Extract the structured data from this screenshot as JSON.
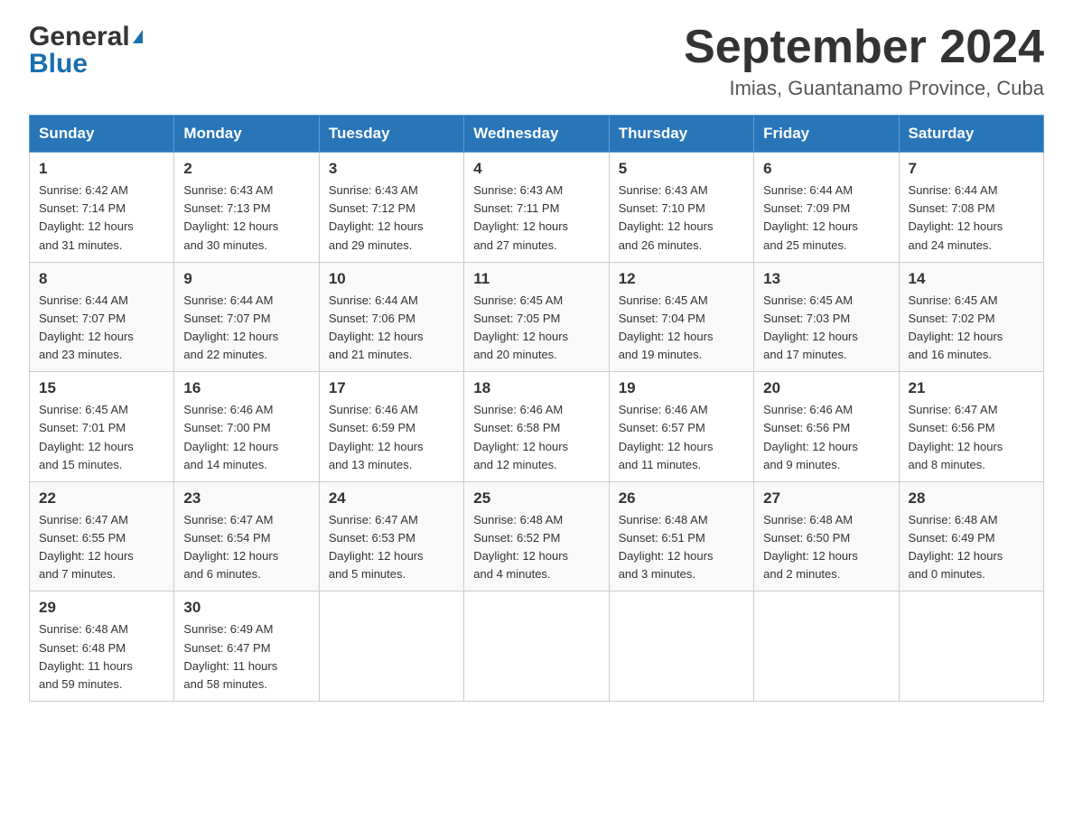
{
  "header": {
    "logo_general": "General",
    "logo_blue": "Blue",
    "month_title": "September 2024",
    "location": "Imias, Guantanamo Province, Cuba"
  },
  "columns": [
    "Sunday",
    "Monday",
    "Tuesday",
    "Wednesday",
    "Thursday",
    "Friday",
    "Saturday"
  ],
  "weeks": [
    [
      {
        "day": "1",
        "sunrise": "6:42 AM",
        "sunset": "7:14 PM",
        "daylight": "12 hours and 31 minutes."
      },
      {
        "day": "2",
        "sunrise": "6:43 AM",
        "sunset": "7:13 PM",
        "daylight": "12 hours and 30 minutes."
      },
      {
        "day": "3",
        "sunrise": "6:43 AM",
        "sunset": "7:12 PM",
        "daylight": "12 hours and 29 minutes."
      },
      {
        "day": "4",
        "sunrise": "6:43 AM",
        "sunset": "7:11 PM",
        "daylight": "12 hours and 27 minutes."
      },
      {
        "day": "5",
        "sunrise": "6:43 AM",
        "sunset": "7:10 PM",
        "daylight": "12 hours and 26 minutes."
      },
      {
        "day": "6",
        "sunrise": "6:44 AM",
        "sunset": "7:09 PM",
        "daylight": "12 hours and 25 minutes."
      },
      {
        "day": "7",
        "sunrise": "6:44 AM",
        "sunset": "7:08 PM",
        "daylight": "12 hours and 24 minutes."
      }
    ],
    [
      {
        "day": "8",
        "sunrise": "6:44 AM",
        "sunset": "7:07 PM",
        "daylight": "12 hours and 23 minutes."
      },
      {
        "day": "9",
        "sunrise": "6:44 AM",
        "sunset": "7:07 PM",
        "daylight": "12 hours and 22 minutes."
      },
      {
        "day": "10",
        "sunrise": "6:44 AM",
        "sunset": "7:06 PM",
        "daylight": "12 hours and 21 minutes."
      },
      {
        "day": "11",
        "sunrise": "6:45 AM",
        "sunset": "7:05 PM",
        "daylight": "12 hours and 20 minutes."
      },
      {
        "day": "12",
        "sunrise": "6:45 AM",
        "sunset": "7:04 PM",
        "daylight": "12 hours and 19 minutes."
      },
      {
        "day": "13",
        "sunrise": "6:45 AM",
        "sunset": "7:03 PM",
        "daylight": "12 hours and 17 minutes."
      },
      {
        "day": "14",
        "sunrise": "6:45 AM",
        "sunset": "7:02 PM",
        "daylight": "12 hours and 16 minutes."
      }
    ],
    [
      {
        "day": "15",
        "sunrise": "6:45 AM",
        "sunset": "7:01 PM",
        "daylight": "12 hours and 15 minutes."
      },
      {
        "day": "16",
        "sunrise": "6:46 AM",
        "sunset": "7:00 PM",
        "daylight": "12 hours and 14 minutes."
      },
      {
        "day": "17",
        "sunrise": "6:46 AM",
        "sunset": "6:59 PM",
        "daylight": "12 hours and 13 minutes."
      },
      {
        "day": "18",
        "sunrise": "6:46 AM",
        "sunset": "6:58 PM",
        "daylight": "12 hours and 12 minutes."
      },
      {
        "day": "19",
        "sunrise": "6:46 AM",
        "sunset": "6:57 PM",
        "daylight": "12 hours and 11 minutes."
      },
      {
        "day": "20",
        "sunrise": "6:46 AM",
        "sunset": "6:56 PM",
        "daylight": "12 hours and 9 minutes."
      },
      {
        "day": "21",
        "sunrise": "6:47 AM",
        "sunset": "6:56 PM",
        "daylight": "12 hours and 8 minutes."
      }
    ],
    [
      {
        "day": "22",
        "sunrise": "6:47 AM",
        "sunset": "6:55 PM",
        "daylight": "12 hours and 7 minutes."
      },
      {
        "day": "23",
        "sunrise": "6:47 AM",
        "sunset": "6:54 PM",
        "daylight": "12 hours and 6 minutes."
      },
      {
        "day": "24",
        "sunrise": "6:47 AM",
        "sunset": "6:53 PM",
        "daylight": "12 hours and 5 minutes."
      },
      {
        "day": "25",
        "sunrise": "6:48 AM",
        "sunset": "6:52 PM",
        "daylight": "12 hours and 4 minutes."
      },
      {
        "day": "26",
        "sunrise": "6:48 AM",
        "sunset": "6:51 PM",
        "daylight": "12 hours and 3 minutes."
      },
      {
        "day": "27",
        "sunrise": "6:48 AM",
        "sunset": "6:50 PM",
        "daylight": "12 hours and 2 minutes."
      },
      {
        "day": "28",
        "sunrise": "6:48 AM",
        "sunset": "6:49 PM",
        "daylight": "12 hours and 0 minutes."
      }
    ],
    [
      {
        "day": "29",
        "sunrise": "6:48 AM",
        "sunset": "6:48 PM",
        "daylight": "11 hours and 59 minutes."
      },
      {
        "day": "30",
        "sunrise": "6:49 AM",
        "sunset": "6:47 PM",
        "daylight": "11 hours and 58 minutes."
      },
      null,
      null,
      null,
      null,
      null
    ]
  ],
  "labels": {
    "sunrise_prefix": "Sunrise: ",
    "sunset_prefix": "Sunset: ",
    "daylight_prefix": "Daylight: "
  }
}
